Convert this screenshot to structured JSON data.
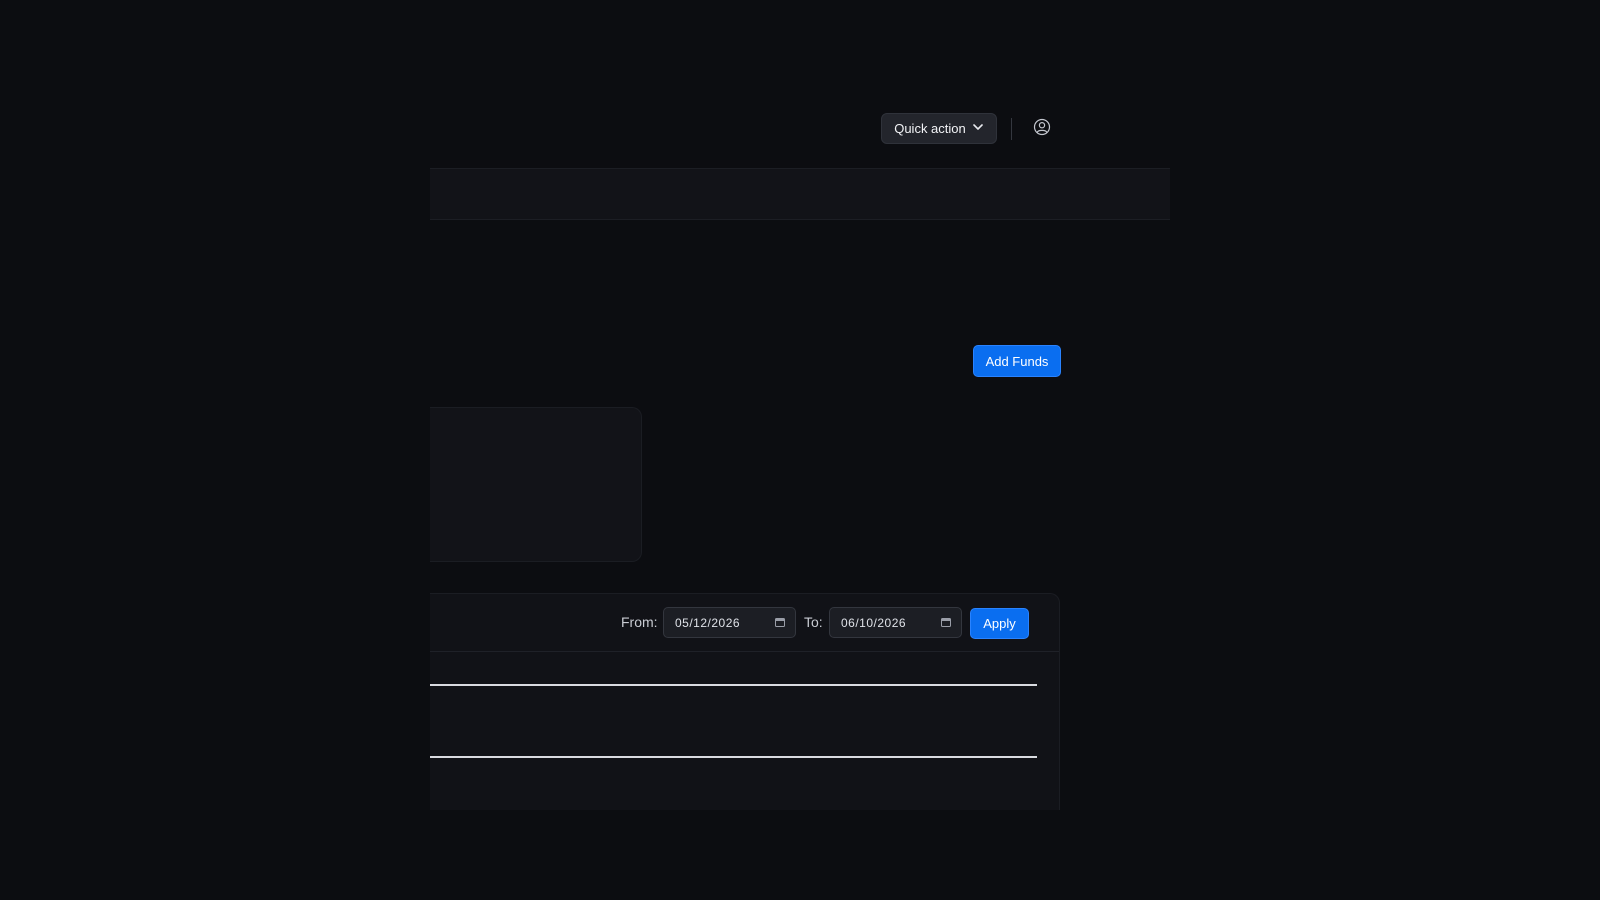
{
  "header": {
    "quick_action_label": "Quick action",
    "profile_icon": "user-circle-icon",
    "dropdown_icon": "chevron-down-icon"
  },
  "wallet": {
    "add_funds_label": "Add Funds"
  },
  "filters": {
    "from_label": "From:",
    "from_value": "05/12/2026",
    "to_label": "To:",
    "to_value": "06/10/2026",
    "apply_label": "Apply",
    "calendar_icon": "calendar-icon"
  },
  "colors": {
    "background": "#0c0d11",
    "panel": "#121318",
    "accent": "#0a6ef0",
    "button_dark": "#23252c"
  }
}
